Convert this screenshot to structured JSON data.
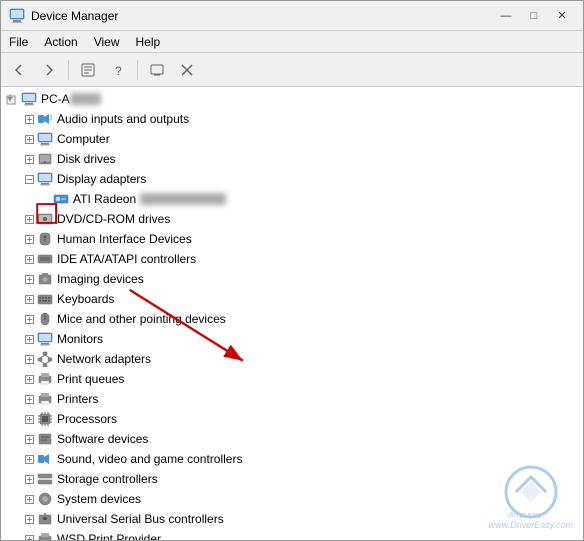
{
  "window": {
    "title": "Device Manager",
    "controls": {
      "minimize": "—",
      "maximize": "□",
      "close": "✕"
    }
  },
  "menu": {
    "items": [
      "File",
      "Action",
      "View",
      "Help"
    ]
  },
  "toolbar": {
    "buttons": [
      "←",
      "→",
      "⊞",
      "?",
      "▤",
      "⊟"
    ]
  },
  "tree": {
    "root": {
      "label": "PC-A",
      "blurred": "████",
      "expanded": true
    },
    "items": [
      {
        "id": "audio",
        "indent": 1,
        "expandable": true,
        "icon": "audio",
        "label": "Audio inputs and outputs"
      },
      {
        "id": "computer",
        "indent": 1,
        "expandable": true,
        "icon": "computer",
        "label": "Computer"
      },
      {
        "id": "disk",
        "indent": 1,
        "expandable": true,
        "icon": "disk",
        "label": "Disk drives"
      },
      {
        "id": "display",
        "indent": 1,
        "expandable": true,
        "icon": "display",
        "label": "Display adapters",
        "expanded": true
      },
      {
        "id": "ati",
        "indent": 2,
        "expandable": false,
        "icon": "gpu",
        "label": "ATI Radeon",
        "blurred": "███████████"
      },
      {
        "id": "dvd",
        "indent": 1,
        "expandable": true,
        "icon": "dvd",
        "label": "DVD/CD-ROM drives"
      },
      {
        "id": "hid",
        "indent": 1,
        "expandable": true,
        "icon": "hid",
        "label": "Human Interface Devices"
      },
      {
        "id": "ide",
        "indent": 1,
        "expandable": true,
        "icon": "ide",
        "label": "IDE ATA/ATAPI controllers"
      },
      {
        "id": "imaging",
        "indent": 1,
        "expandable": true,
        "icon": "imaging",
        "label": "Imaging devices"
      },
      {
        "id": "keyboards",
        "indent": 1,
        "expandable": true,
        "icon": "keyboard",
        "label": "Keyboards"
      },
      {
        "id": "mice",
        "indent": 1,
        "expandable": true,
        "icon": "mouse",
        "label": "Mice and other pointing devices"
      },
      {
        "id": "monitors",
        "indent": 1,
        "expandable": true,
        "icon": "monitor",
        "label": "Monitors"
      },
      {
        "id": "network",
        "indent": 1,
        "expandable": true,
        "icon": "network",
        "label": "Network adapters"
      },
      {
        "id": "printq",
        "indent": 1,
        "expandable": true,
        "icon": "printq",
        "label": "Print queues"
      },
      {
        "id": "printers",
        "indent": 1,
        "expandable": true,
        "icon": "printer",
        "label": "Printers"
      },
      {
        "id": "processors",
        "indent": 1,
        "expandable": true,
        "icon": "processor",
        "label": "Processors"
      },
      {
        "id": "software",
        "indent": 1,
        "expandable": true,
        "icon": "software",
        "label": "Software devices"
      },
      {
        "id": "sound",
        "indent": 1,
        "expandable": true,
        "icon": "sound",
        "label": "Sound, video and game controllers"
      },
      {
        "id": "storage",
        "indent": 1,
        "expandable": true,
        "icon": "storage",
        "label": "Storage controllers"
      },
      {
        "id": "system",
        "indent": 1,
        "expandable": true,
        "icon": "system",
        "label": "System devices"
      },
      {
        "id": "usb",
        "indent": 1,
        "expandable": true,
        "icon": "usb",
        "label": "Universal Serial Bus controllers"
      },
      {
        "id": "wsd",
        "indent": 1,
        "expandable": true,
        "icon": "wsd",
        "label": "WSD Print Provider"
      }
    ]
  },
  "watermark": {
    "text": "www.DriverEasy.com"
  },
  "colors": {
    "accent": "#4a90d9",
    "red_arrow": "#cc0000",
    "background": "#ffffff"
  }
}
